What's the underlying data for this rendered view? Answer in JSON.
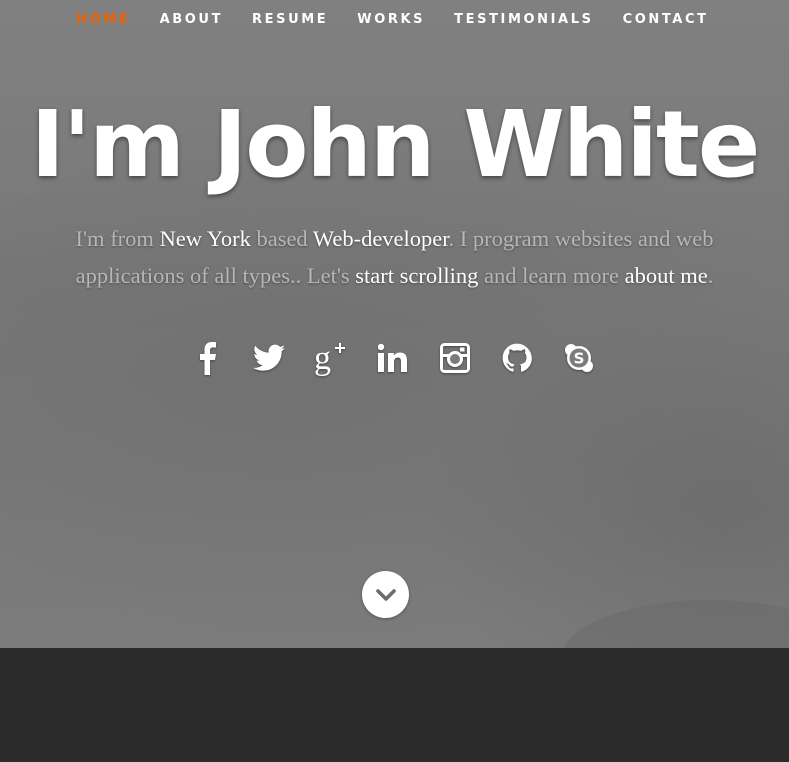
{
  "nav": {
    "items": [
      {
        "label": "HOME",
        "active": true
      },
      {
        "label": "ABOUT",
        "active": false
      },
      {
        "label": "RESUME",
        "active": false
      },
      {
        "label": "WORKS",
        "active": false
      },
      {
        "label": "TESTIMONIALS",
        "active": false
      },
      {
        "label": "CONTACT",
        "active": false
      }
    ],
    "active_color": "#f06000"
  },
  "hero": {
    "title": "I'm John White",
    "intro": {
      "p1": "I'm from ",
      "location": "New York",
      "p2": " based ",
      "role": "Web-developer",
      "p3": ". I program websites and web applications of all types.. Let's ",
      "scroll_link": "start scrolling",
      "p4": " and learn more ",
      "about_link": "about me",
      "p5": "."
    },
    "social_icons": [
      "facebook-icon",
      "twitter-icon",
      "google-plus-icon",
      "linkedin-icon",
      "instagram-icon",
      "github-icon",
      "skype-icon"
    ]
  },
  "scroll_button": {
    "icon": "chevron-down-icon"
  },
  "colors": {
    "hero_bg": "#7b7b7b",
    "section_bg": "#2b2b2b",
    "intro_text": "#b7b7b7",
    "highlight": "#ffffff"
  }
}
